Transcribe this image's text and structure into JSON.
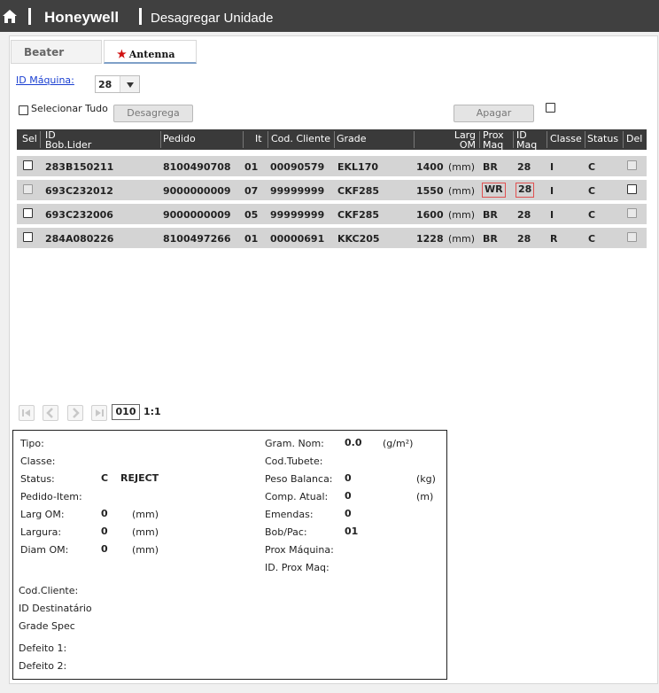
{
  "header": {
    "brand": "Honeywell",
    "title": "Desagregar Unidade"
  },
  "tabs": [
    {
      "label": "Beater",
      "active": false
    },
    {
      "label": "Antenna",
      "active": true,
      "marker": "★"
    }
  ],
  "filter": {
    "machine_label": "ID Máquina:",
    "machine_value": "28",
    "select_all_label": "Selecionar Tudo",
    "disaggregate_button": "Desagrega",
    "delete_button": "Apagar"
  },
  "grid": {
    "columns": {
      "sel": "Sel",
      "id_line1": "ID",
      "id_line2": "Bob.Lider",
      "pedido": "Pedido",
      "it": "It",
      "cod_cliente": "Cod. Cliente",
      "grade": "Grade",
      "larg_line1": "Larg",
      "larg_line2": "OM",
      "prox_line1": "Prox",
      "prox_line2": "Maq",
      "idmaq_line1": "ID",
      "idmaq_line2": "Maq",
      "classe": "Classe",
      "status": "Status",
      "del": "Del"
    },
    "rows": [
      {
        "id": "283B150211",
        "pedido": "8100490708",
        "it": "01",
        "cod_cliente": "00090579",
        "grade": "EKL170",
        "larg": "1400",
        "unit": "(mm)",
        "prox": "BR",
        "idmaq": "28",
        "classe": "I",
        "status": "C",
        "selectable": true,
        "highlight": false
      },
      {
        "id": "693C232012",
        "pedido": "9000000009",
        "it": "07",
        "cod_cliente": "99999999",
        "grade": "CKF285",
        "larg": "1550",
        "unit": "(mm)",
        "prox": "WR",
        "idmaq": "28",
        "classe": "I",
        "status": "C",
        "selectable": false,
        "highlight": true
      },
      {
        "id": "693C232006",
        "pedido": "9000000009",
        "it": "05",
        "cod_cliente": "99999999",
        "grade": "CKF285",
        "larg": "1600",
        "unit": "(mm)",
        "prox": "BR",
        "idmaq": "28",
        "classe": "I",
        "status": "C",
        "selectable": true,
        "highlight": false
      },
      {
        "id": "284A080226",
        "pedido": "8100497266",
        "it": "01",
        "cod_cliente": "00000691",
        "grade": "KKC205",
        "larg": "1228",
        "unit": "(mm)",
        "prox": "BR",
        "idmaq": "28",
        "classe": "R",
        "status": "C",
        "selectable": true,
        "highlight": false
      }
    ]
  },
  "pager": {
    "page": "010",
    "info": "1:1"
  },
  "details": {
    "tipo_label": "Tipo:",
    "classe_label": "Classe:",
    "status_label": "Status:",
    "status_code": "C",
    "status_text": "REJECT",
    "pedido_item_label": "Pedido-Item:",
    "larg_om_label": "Larg OM:",
    "larg_om_value": "0",
    "larg_om_unit": "(mm)",
    "largura_label": "Largura:",
    "largura_value": "0",
    "largura_unit": "(mm)",
    "diam_om_label": "Diam OM:",
    "diam_om_value": "0",
    "diam_om_unit": "(mm)",
    "gram_nom_label": "Gram. Nom:",
    "gram_nom_value": "0.0",
    "gram_nom_unit": "(g/m²)",
    "cod_tubete_label": "Cod.Tubete:",
    "peso_label": "Peso Balanca:",
    "peso_value": "0",
    "peso_unit": "(kg)",
    "comp_label": "Comp. Atual:",
    "comp_value": "0",
    "comp_unit": "(m)",
    "emendas_label": "Emendas:",
    "emendas_value": "0",
    "bobpac_label": "Bob/Pac:",
    "bobpac_value": "01",
    "prox_maquina_label": "Prox Máquina:",
    "id_prox_maq_label": "ID. Prox Maq:",
    "cod_cliente_label": "Cod.Cliente:",
    "id_destinatario_label": "ID Destinatário",
    "grade_spec_label": "Grade Spec",
    "defeito1_label": "Defeito 1:",
    "defeito2_label": "Defeito 2:"
  }
}
